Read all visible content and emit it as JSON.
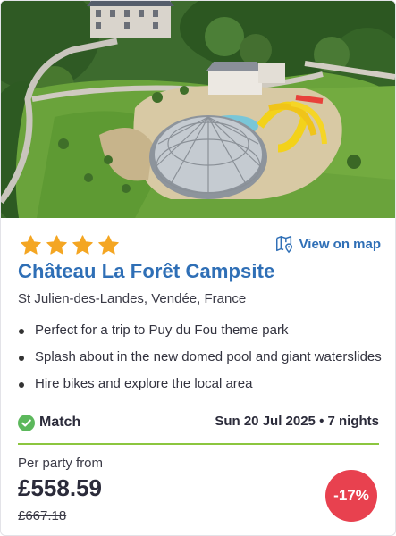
{
  "card": {
    "rating_stars": 4,
    "star_color": "#f4a623",
    "map_link_label": "View on map",
    "title": "Château La Forêt Campsite",
    "location": "St Julien-des-Landes, Vendée, France",
    "features": [
      "Perfect for a trip to Puy du Fou theme park",
      "Splash about in the new domed pool and giant waterslides",
      "Hire bikes and explore the local area"
    ],
    "match_label": "Match",
    "dates": "Sun 20 Jul 2025 • 7 nights",
    "price_prefix": "Per party from",
    "price": "£558.59",
    "old_price": "£667.18",
    "discount": "-17%"
  },
  "colors": {
    "brand_blue": "#2f6fb6",
    "match_green": "#5cb85c",
    "divider_green": "#8cc63f",
    "discount_red": "#e8414f"
  }
}
